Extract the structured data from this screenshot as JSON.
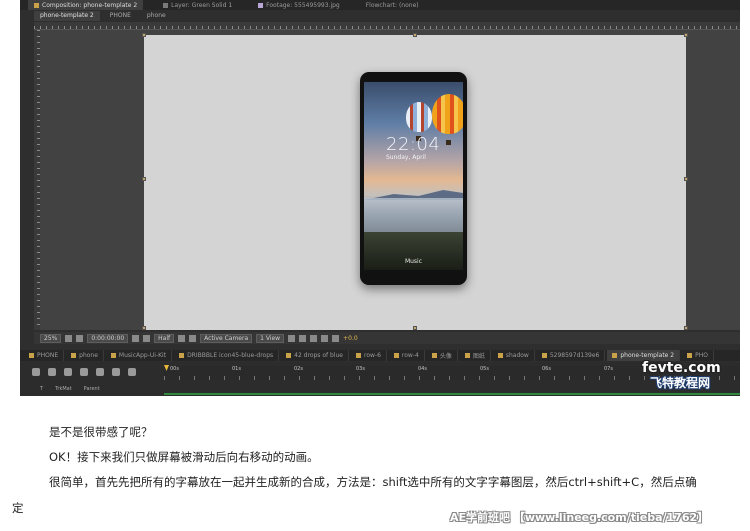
{
  "panel_tabs": {
    "composition": "Composition: phone-template 2",
    "layer": "Layer: Green Solid 1",
    "footage": "Footage: 555495993.jpg",
    "flowchart": "Flowchart: (none)"
  },
  "comp_tabs": [
    "phone-template 2",
    "PHONE",
    "phone"
  ],
  "phone_screen": {
    "time": "22:04",
    "date": "Sunday, April",
    "music": "Music"
  },
  "viewer_bar": {
    "zoom": "25%",
    "timecode": "0:00:00:00",
    "resolution": "Half",
    "camera": "Active Camera",
    "views": "1 View",
    "exposure": "+0.0"
  },
  "timeline_tabs": [
    "PHONE",
    "phone",
    "MusicApp-Ui-Kit",
    "DRIBBBLE icon45-blue-drops",
    "42 drops of blue",
    "row-6",
    "row-4",
    "头像",
    "图纸",
    "shadow",
    "5298597d139e6",
    "phone-template 2",
    "PHO"
  ],
  "timeline": {
    "ticks": [
      "00s",
      "01s",
      "02s",
      "03s",
      "04s",
      "05s",
      "06s",
      "07s"
    ],
    "col_trkmat": "TrkMat",
    "col_parent": "Parent",
    "col_t": "T"
  },
  "overlay_logo": {
    "top": "fevte.com",
    "bottom": "飞特教程网"
  },
  "article": {
    "p1": "是不是很带感了呢？",
    "p2": "OK！接下来我们只做屏幕被滑动后向右移动的动画。",
    "p3": "很简单，首先先把所有的字幕放在一起并生成新的合成，方法是：shift选中所有的文字字幕图层，然后ctrl+shift+C，然后点确",
    "p4": "定",
    "watermark": "AE学前班吧 【www.lineeg.com/tieba/1762】"
  },
  "colors": {
    "ae_bg": "#2e2e2e",
    "canvas_bg": "#d4d4d4",
    "accent_orange": "#e7b73a",
    "work_area_green": "#2f8a3d"
  }
}
